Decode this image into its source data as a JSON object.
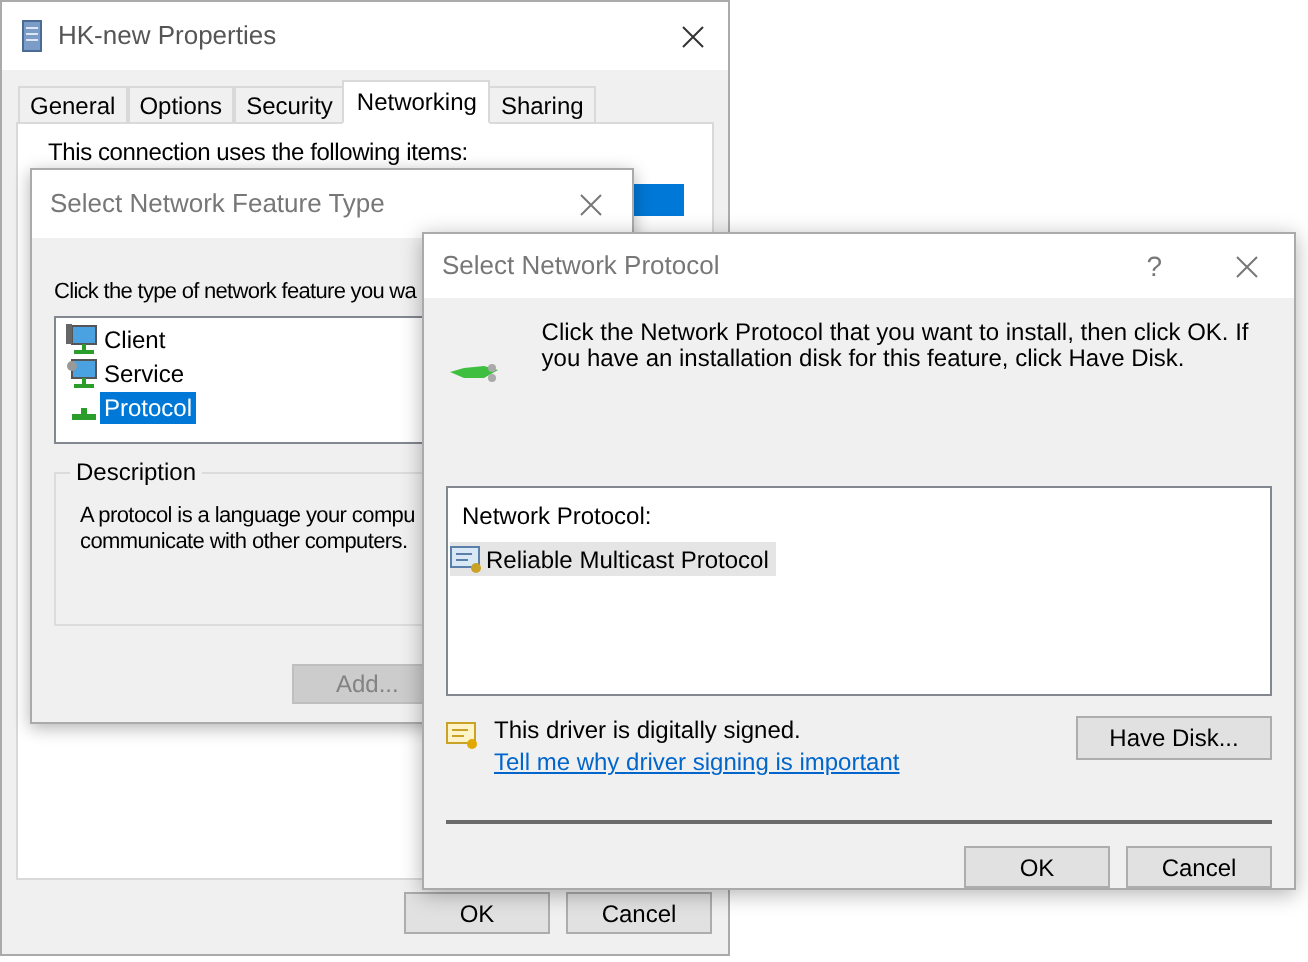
{
  "properties_window": {
    "title": "HK-new Properties",
    "tabs": [
      {
        "label": "General",
        "selected": false
      },
      {
        "label": "Options",
        "selected": false
      },
      {
        "label": "Security",
        "selected": false
      },
      {
        "label": "Networking",
        "selected": true
      },
      {
        "label": "Sharing",
        "selected": false
      }
    ],
    "items_label": "This connection uses the following items:",
    "buttons": [
      "OK",
      "Cancel"
    ]
  },
  "feature_type_dialog": {
    "title": "Select Network Feature Type",
    "prompt": "Click the type of network feature you wa",
    "features": [
      {
        "kind": "client",
        "label": "Client",
        "selected": false
      },
      {
        "kind": "service",
        "label": "Service",
        "selected": false
      },
      {
        "kind": "protocol",
        "label": "Protocol",
        "selected": true
      }
    ],
    "description_title": "Description",
    "description_lines": [
      "A protocol is a language your compu",
      "communicate with other computers."
    ],
    "add_button": {
      "label": "Add...",
      "disabled": true
    }
  },
  "protocol_dialog": {
    "title": "Select Network Protocol",
    "help": "?",
    "instructions": "Click the Network Protocol that you want to install, then click OK. If you have an installation disk for this feature, click Have Disk.",
    "list_header": "Network Protocol:",
    "protocols": [
      {
        "label": "Reliable Multicast Protocol",
        "selected": true
      }
    ],
    "signed_note": "This driver is digitally signed.",
    "signing_link": "Tell me why driver signing is important",
    "have_disk_button": "Have Disk...",
    "buttons": [
      "OK",
      "Cancel"
    ]
  }
}
